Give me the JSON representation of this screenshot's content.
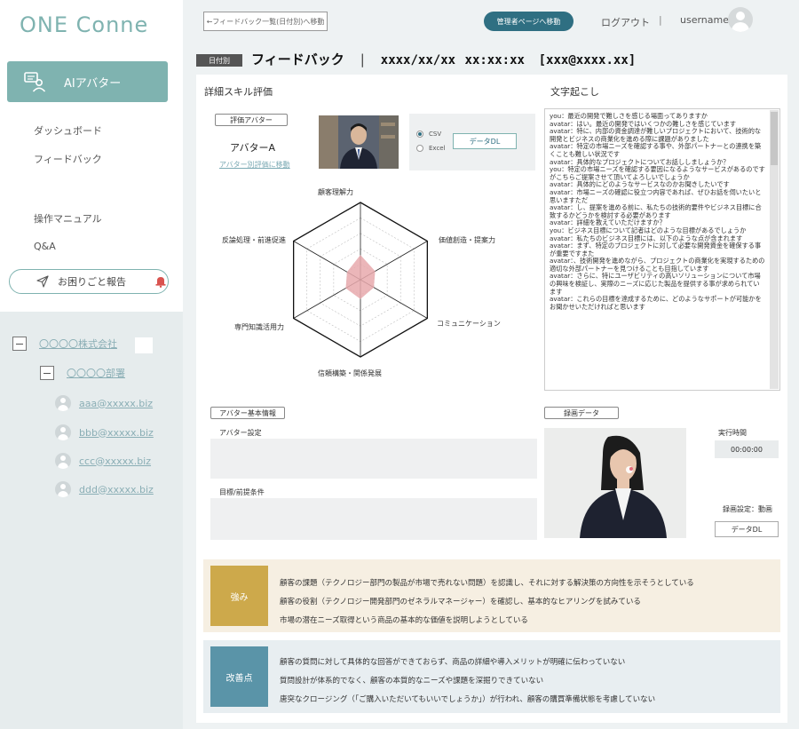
{
  "logo": "ONE Conne",
  "sidebar": {
    "active_item": "AIアバター",
    "links": [
      "ダッシュボード",
      "フィードバック",
      "操作マニュアル",
      "Q&A"
    ],
    "trouble_button": "お困りごと報告"
  },
  "tree": {
    "company": "〇〇〇〇株式会社",
    "department": "〇〇〇〇部署",
    "users": [
      "aaa@xxxxx.biz",
      "bbb@xxxxx.biz",
      "ccc@xxxxx.biz",
      "ddd@xxxxx.biz"
    ]
  },
  "header": {
    "back_button": "←フィードバック一覧(日付別)へ移動",
    "admin_button": "管理者ページへ移動",
    "logout": "ログアウト",
    "separator": "|",
    "username": "username"
  },
  "page": {
    "date_badge": "日付別",
    "title": "フィードバック",
    "divider": "|",
    "date": "xxxx/xx/xx",
    "time": "xx:xx:xx",
    "email": "[xxx@xxxx.xx]"
  },
  "skill": {
    "section_title": "詳細スキル評価",
    "avatar_tag": "評価アバター",
    "avatar_name": "アバターA",
    "avatar_link": "アバター別評価に移動",
    "format_options": [
      "CSV",
      "Excel"
    ],
    "selected_format": "CSV",
    "download_button": "データDL",
    "radar": {
      "axes": [
        "顧客理解力",
        "価値創造・提案力",
        "コミュニケーション",
        "信頼構築・関係発展",
        "専門知識活用力",
        "反論処理・前進促進"
      ],
      "levels": 5,
      "values": [
        0.32,
        0.22,
        0.2,
        0.25,
        0.22,
        0.2
      ],
      "fill_color": "#e7a9ad"
    }
  },
  "transcript": {
    "section_title": "文字起こし",
    "text": "you：最近の開発で難しさを感じる場面ってありますか\navatar：はい。最近の開発ではいくつかの難しさを感じています\navatar：特に、内部の資金調達が難しいプロジェクトにおいて、技術的な開発とビジネスの商業化を進める際に課題がありました\navatar：特定の市場ニーズを確認する事や、外部パートナーとの連携を築くことも難しい状況です\navatar：具体的なプロジェクトについてお話ししましょうか？\nyou：特定の市場ニーズを確認する要因になるようなサービスがあるのですがこちらご提案させて頂いてよろしいでしょうか\navatar：具体的にどのようなサービスなのかお聞きしたいです\navatar：市場ニーズの確認に役立つ内容であれば、ぜひお話を伺いたいと思いますただ\navatar：し、提案を進める前に、私たちの技術的要件やビジネス目標に合致するかどうかを検討する必要があります\navatar：詳細を教えていただけますか？\nyou：ビジネス目標について記者はどのような目標があるでしょうか\navatar：私たちのビジネス目標には、以下のような点が含まれます\navatar：まず、特定のプロジェクトに対して必要な開発資金を確保する事が重要ですまた\navatar：、技術開発を進めながら、プロジェクトの商業化を実現するための適切な外部パートナーを見つけることも目指しています\navatar：さらに、特にユーザビリティの高いソリューションについて市場の興味を検証し、実際のニーズに応じた製品を提供する事が求められています\navatar：これらの目標を達成するために、どのようなサポートが可能かをお聞かせいただければと思います"
  },
  "basic_info": {
    "tag": "アバター基本情報",
    "setting_label": "アバター設定",
    "goal_label": "目標/前提条件"
  },
  "recording": {
    "tag": "録画データ",
    "exec_time_label": "実行時間",
    "exec_time": "00:00:00",
    "setting_label": "録画設定：動画",
    "download_button": "データDL"
  },
  "strengths": {
    "badge": "強み",
    "badge_color": "#cda94b",
    "points": [
      "顧客の課題（テクノロジー部門の製品が市場で売れない問題）を認識し、それに対する解決策の方向性を示そうとしている",
      "顧客の役割（テクノロジー開発部門のゼネラルマネージャー）を確認し、基本的なヒアリングを試みている",
      "市場の潜在ニーズ取得という商品の基本的な価値を説明しようとしている"
    ]
  },
  "improvements": {
    "badge": "改善点",
    "badge_color": "#5a94a8",
    "points": [
      "顧客の質問に対して具体的な回答ができておらず、商品の詳細や導入メリットが明確に伝わっていない",
      "質問設計が体系的でなく、顧客の本質的なニーズや課題を深掘りできていない",
      "唐突なクロージング（「ご購入いただいてもいいでしょうか」）が行われ、顧客の購買準備状態を考慮していない"
    ]
  },
  "colors": {
    "accent": "#7fb3b0",
    "admin_button": "#2f6f82",
    "link": "#8aaeb5"
  }
}
